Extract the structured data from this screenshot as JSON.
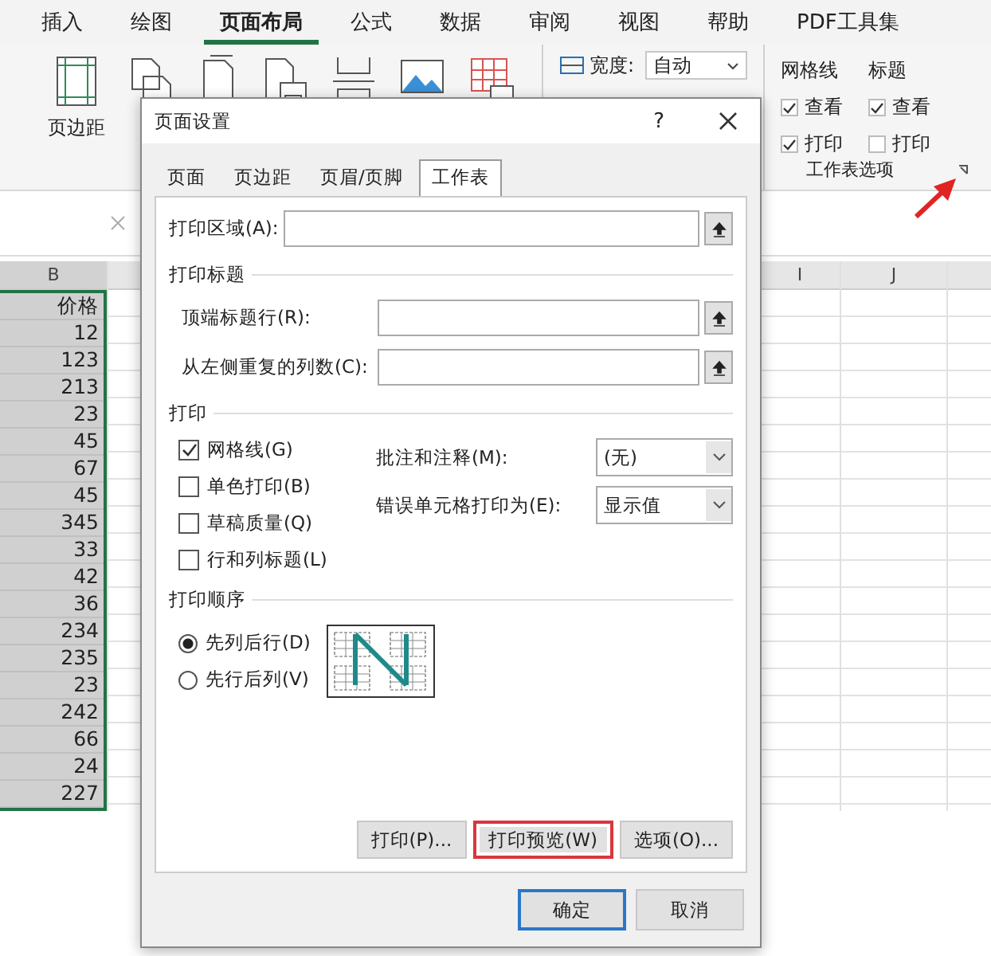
{
  "ribbon_tabs": [
    {
      "label": "插入",
      "selected": false
    },
    {
      "label": "绘图",
      "selected": false
    },
    {
      "label": "页面布局",
      "selected": true
    },
    {
      "label": "公式",
      "selected": false
    },
    {
      "label": "数据",
      "selected": false
    },
    {
      "label": "审阅",
      "selected": false
    },
    {
      "label": "视图",
      "selected": false
    },
    {
      "label": "帮助",
      "selected": false
    },
    {
      "label": "PDF工具集",
      "selected": false
    }
  ],
  "ribbon": {
    "margins_label": "页边距",
    "width_label": "宽度:",
    "width_value": "自动",
    "sheet_options": [
      {
        "title": "网格线",
        "items": [
          {
            "label": "查看",
            "checked": true
          },
          {
            "label": "打印",
            "checked": true
          }
        ]
      },
      {
        "title": "标题",
        "items": [
          {
            "label": "查看",
            "checked": true
          },
          {
            "label": "打印",
            "checked": false
          }
        ]
      }
    ],
    "group_label": "工作表选项"
  },
  "sheet": {
    "column_headers": [
      "B",
      "I",
      "J"
    ],
    "cells": [
      "价格",
      "12",
      "123",
      "213",
      "23",
      "45",
      "67",
      "45",
      "345",
      "33",
      "42",
      "36",
      "234",
      "235",
      "23",
      "242",
      "66",
      "24",
      "227"
    ]
  },
  "dialog": {
    "title": "页面设置",
    "help": "?",
    "tabs": [
      {
        "label": "页面",
        "selected": false
      },
      {
        "label": "页边距",
        "selected": false
      },
      {
        "label": "页眉/页脚",
        "selected": false
      },
      {
        "label": "工作表",
        "selected": true
      }
    ],
    "print_area_label": "打印区域(A):",
    "print_titles": {
      "heading": "打印标题",
      "fields": [
        {
          "label": "顶端标题行(R):"
        },
        {
          "label": "从左侧重复的列数(C):"
        }
      ]
    },
    "print": {
      "heading": "打印",
      "options": [
        {
          "label": "网格线(G)",
          "checked": true
        },
        {
          "label": "单色打印(B)",
          "checked": false
        },
        {
          "label": "草稿质量(Q)",
          "checked": false
        },
        {
          "label": "行和列标题(L)",
          "checked": false
        }
      ],
      "dropdowns": [
        {
          "label": "批注和注释(M):",
          "value": "(无)"
        },
        {
          "label": "错误单元格打印为(E):",
          "value": "显示值"
        }
      ]
    },
    "page_order": {
      "heading": "打印顺序",
      "options": [
        {
          "label": "先列后行(D)",
          "selected": true
        },
        {
          "label": "先行后列(V)",
          "selected": false
        }
      ]
    },
    "buttons": [
      {
        "label": "打印(P)...",
        "highlighted": false
      },
      {
        "label": "打印预览(W)",
        "highlighted": true
      },
      {
        "label": "选项(O)...",
        "highlighted": false
      }
    ],
    "footer_buttons": [
      {
        "label": "确定",
        "default": true
      },
      {
        "label": "取消",
        "default": false
      }
    ]
  }
}
